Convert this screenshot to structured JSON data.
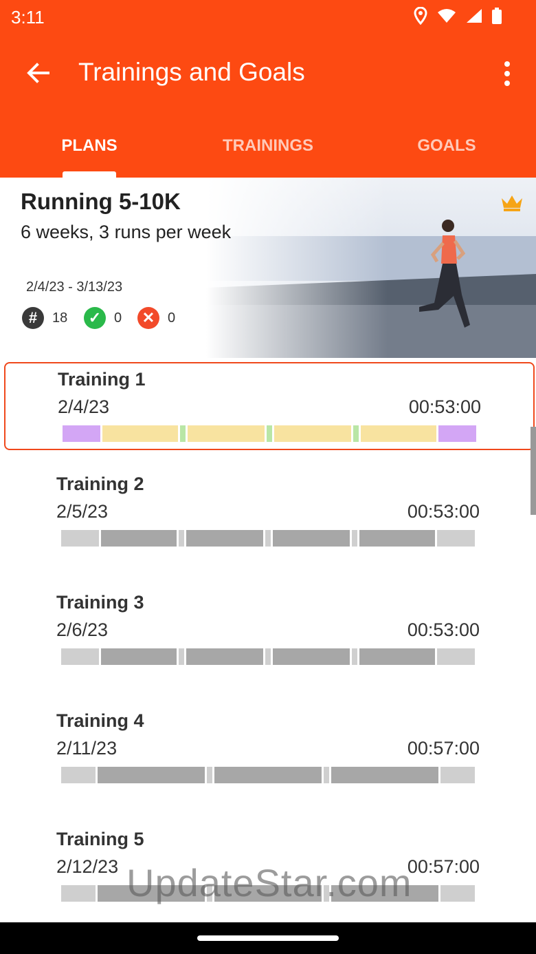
{
  "status_bar": {
    "time": "3:11"
  },
  "app_bar": {
    "title": "Trainings and Goals"
  },
  "tabs": [
    {
      "label": "PLANS",
      "active": true
    },
    {
      "label": "TRAININGS",
      "active": false
    },
    {
      "label": "GOALS",
      "active": false
    }
  ],
  "plan": {
    "title": "Running 5-10K",
    "subtitle": "6 weeks, 3 runs per week",
    "date_range": "2/4/23 - 3/13/23",
    "stats": {
      "total": "18",
      "completed": "0",
      "missed": "0"
    }
  },
  "trainings": [
    {
      "name": "Training 1",
      "date": "2/4/23",
      "duration": "00:53:00",
      "selected": true
    },
    {
      "name": "Training 2",
      "date": "2/5/23",
      "duration": "00:53:00",
      "selected": false
    },
    {
      "name": "Training 3",
      "date": "2/6/23",
      "duration": "00:53:00",
      "selected": false
    },
    {
      "name": "Training 4",
      "date": "2/11/23",
      "duration": "00:57:00",
      "selected": false
    },
    {
      "name": "Training 5",
      "date": "2/12/23",
      "duration": "00:57:00",
      "selected": false
    }
  ],
  "watermark": "UpdateStar.com",
  "colors": {
    "accent": "#fd4a12",
    "warmup": "#d3a6f5",
    "run": "#f8e3a0",
    "walk": "#b9e6a6",
    "inactive_light": "#cfcfcf",
    "inactive_dark": "#a7a7a7"
  }
}
